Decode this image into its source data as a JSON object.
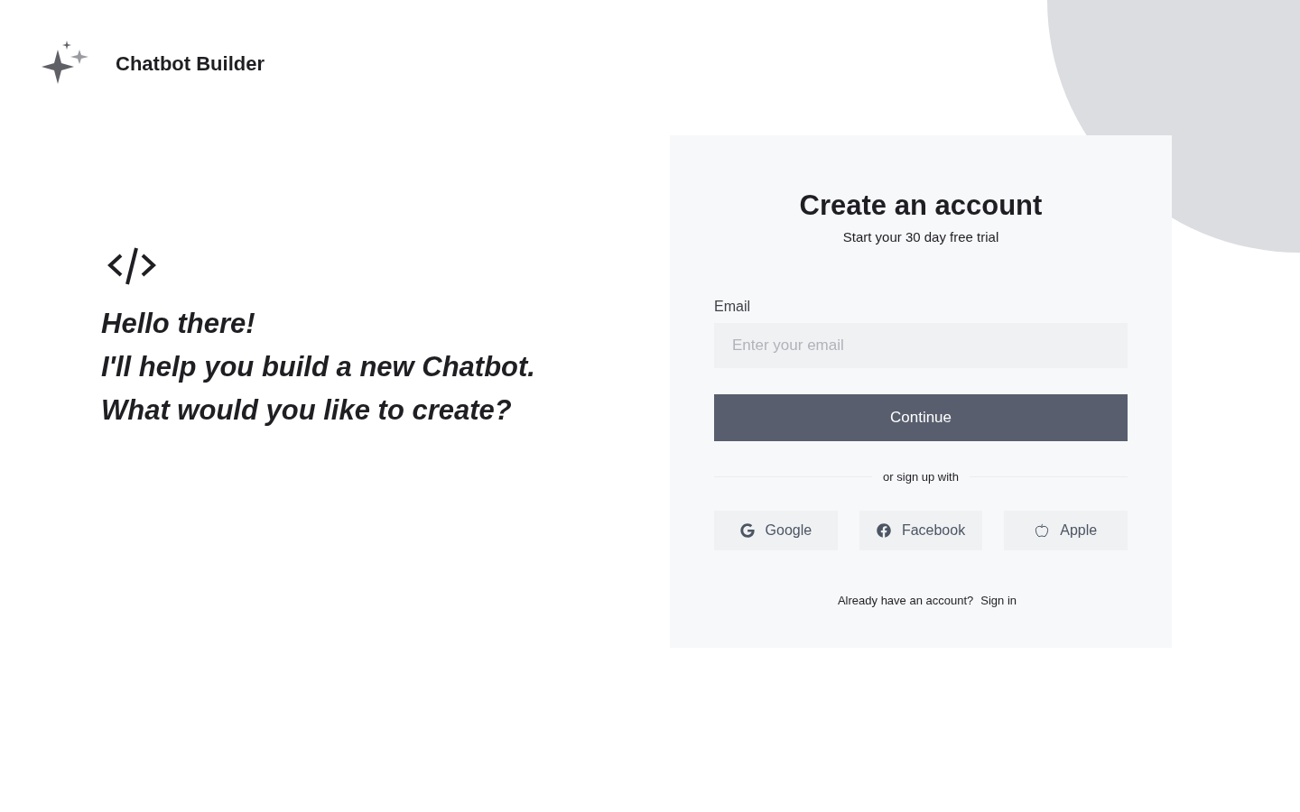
{
  "brand": {
    "name": "Chatbot Builder"
  },
  "greeting": {
    "lines": [
      "Hello there!",
      "I'll help you build a new Chatbot.",
      "What would you like to create?"
    ]
  },
  "signup": {
    "title": "Create an account",
    "subtitle": "Start your 30 day free trial",
    "email": {
      "label": "Email",
      "placeholder": "Enter your email"
    },
    "continue": "Continue",
    "divider": "or sign up with",
    "providers": [
      {
        "kind": "google",
        "label": "Google"
      },
      {
        "kind": "facebook",
        "label": "Facebook"
      },
      {
        "kind": "apple",
        "label": "Apple"
      }
    ],
    "footer": {
      "text": "Already have an account?",
      "link": "Sign in"
    }
  }
}
